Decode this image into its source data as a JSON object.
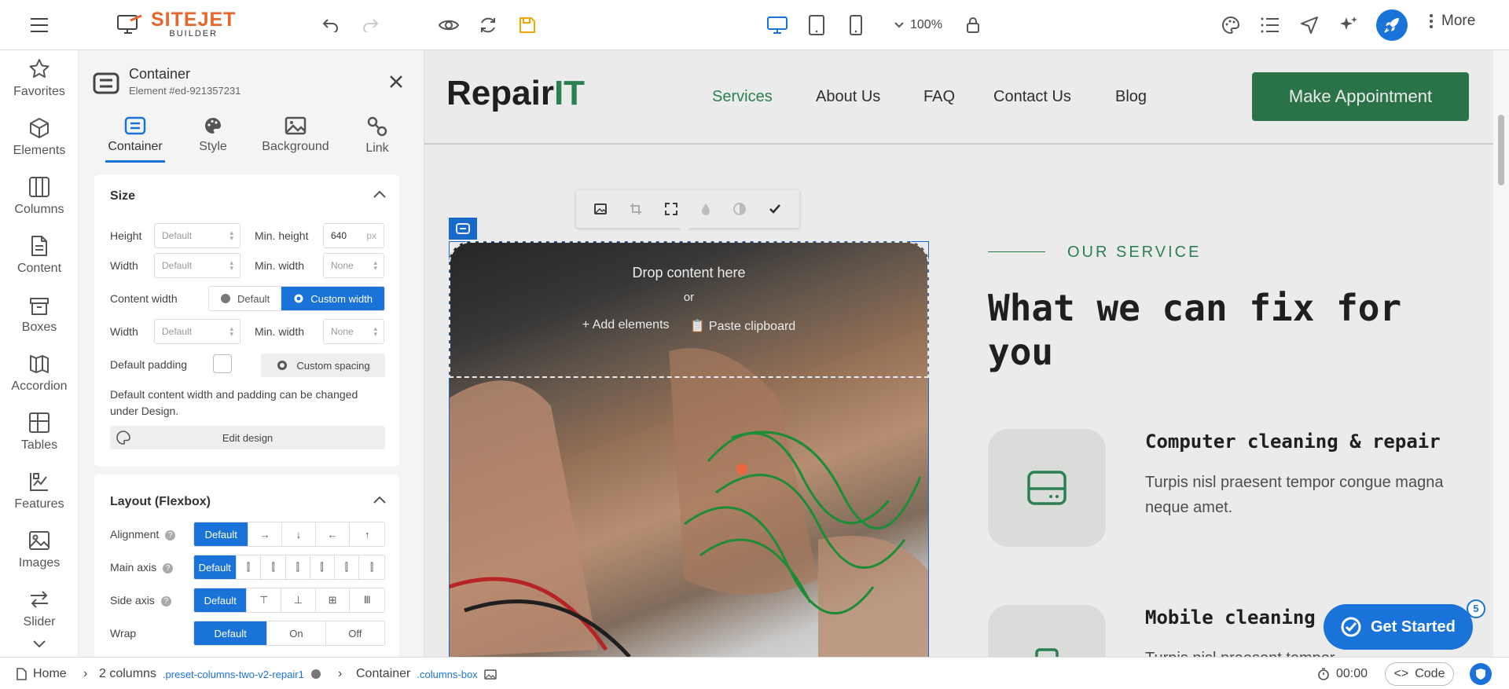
{
  "topbar": {
    "logo_brand": "SITEJET",
    "logo_sub": "BUILDER",
    "zoom": "100%",
    "more_label": "More"
  },
  "rail": {
    "items": [
      {
        "label": "Favorites",
        "icon": "star-icon"
      },
      {
        "label": "Elements",
        "icon": "cube-icon"
      },
      {
        "label": "Columns",
        "icon": "columns-icon"
      },
      {
        "label": "Content",
        "icon": "document-icon"
      },
      {
        "label": "Boxes",
        "icon": "box-icon"
      },
      {
        "label": "Accordion",
        "icon": "accordion-icon"
      },
      {
        "label": "Tables",
        "icon": "table-icon"
      },
      {
        "label": "Features",
        "icon": "features-icon"
      },
      {
        "label": "Images",
        "icon": "image-icon"
      },
      {
        "label": "Slider",
        "icon": "slider-icon"
      }
    ]
  },
  "panel": {
    "title": "Container",
    "subtitle": "Element #ed-921357231",
    "tabs": [
      {
        "label": "Container",
        "icon": "container-icon"
      },
      {
        "label": "Style",
        "icon": "palette-icon"
      },
      {
        "label": "Background",
        "icon": "image-icon"
      },
      {
        "label": "Link",
        "icon": "link-icon"
      }
    ],
    "size": {
      "title": "Size",
      "height_label": "Height",
      "height_value": "Default",
      "min_height_label": "Min. height",
      "min_height_value": "640",
      "min_height_unit": "px",
      "width_label": "Width",
      "width_value": "Default",
      "min_width_label": "Min. width",
      "min_width_value": "None",
      "content_width_label": "Content width",
      "content_width_default": "Default",
      "content_width_custom": "Custom width",
      "width2_label": "Width",
      "width2_value": "Default",
      "min_width2_label": "Min. width",
      "min_width2_value": "None",
      "default_padding_label": "Default padding",
      "custom_spacing": "Custom spacing",
      "note": "Default content width and padding can be changed under Design.",
      "edit_design": "Edit design"
    },
    "layout": {
      "title": "Layout (Flexbox)",
      "alignment_label": "Alignment",
      "main_axis_label": "Main axis",
      "side_axis_label": "Side axis",
      "wrap_label": "Wrap",
      "default": "Default",
      "on": "On",
      "off": "Off"
    }
  },
  "canvas": {
    "site_logo_a": "Repair",
    "site_logo_b": "IT",
    "nav": [
      "Services",
      "About Us",
      "FAQ",
      "Contact Us",
      "Blog"
    ],
    "cta": "Make Appointment",
    "drop_text": "Drop content here",
    "or_text": "or",
    "add_elements": "Add elements",
    "paste_clipboard": "Paste clipboard",
    "service_label": "OUR SERVICE",
    "service_title": "What we can fix for you",
    "services": [
      {
        "title": "Computer cleaning & repair",
        "text": "Turpis nisl praesent tempor congue magna neque amet."
      },
      {
        "title": "Mobile cleaning",
        "text": "Turpis nisl praesent tempor"
      }
    ],
    "get_started": "Get Started",
    "get_started_badge": "5"
  },
  "bottombar": {
    "home": "Home",
    "columns": "2 columns",
    "columns_class": ".preset-columns-two-v2-repair1",
    "container": "Container",
    "container_class": ".columns-box",
    "timer": "00:00",
    "code": "Code"
  },
  "colors": {
    "accent": "#1a73d9",
    "brand_orange": "#e8652b",
    "site_green": "#2e7d4f"
  }
}
